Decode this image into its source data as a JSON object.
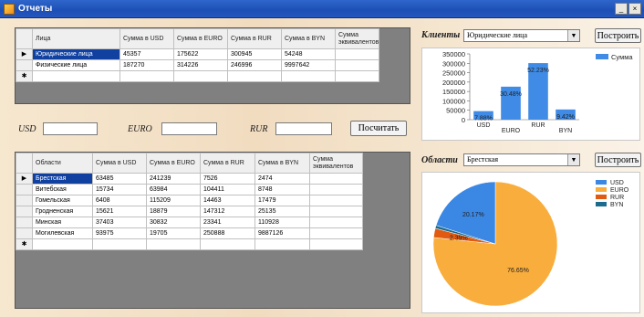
{
  "window": {
    "title": "Отчеты",
    "minimize_label": "_",
    "close_label": "×"
  },
  "clients_grid": {
    "columns": [
      "Лица",
      "Сумма в USD",
      "Сумма в EURO",
      "Сумма в RUR",
      "Сумма в BYN",
      "Сумма эквивалентов"
    ],
    "rows": [
      {
        "marker": "▶",
        "cells": [
          "Юридические лица",
          "45357",
          "175622",
          "300945",
          "54248",
          ""
        ]
      },
      {
        "marker": "",
        "cells": [
          "Физические лица",
          "187270",
          "314226",
          "246996",
          "9997642",
          ""
        ]
      }
    ],
    "new_row_marker": "✱"
  },
  "converter": {
    "usd_label": "USD",
    "usd_value": "",
    "euro_label": "EURO",
    "euro_value": "",
    "rur_label": "RUR",
    "rur_value": "",
    "calc_button": "Посчитать"
  },
  "regions_grid": {
    "columns": [
      "Области",
      "Сумма в USD",
      "Сумма в EURO",
      "Сумма в RUR",
      "Сумма в BYN",
      "Сумма эквивалентов"
    ],
    "rows": [
      {
        "marker": "▶",
        "cells": [
          "Брестская",
          "63485",
          "241239",
          "7526",
          "2474",
          ""
        ]
      },
      {
        "marker": "",
        "cells": [
          "Витебская",
          "15734",
          "63984",
          "104411",
          "8748",
          ""
        ]
      },
      {
        "marker": "",
        "cells": [
          "Гомельская",
          "6408",
          "115209",
          "14463",
          "17479",
          ""
        ]
      },
      {
        "marker": "",
        "cells": [
          "Гродненская",
          "15621",
          "18879",
          "147312",
          "25135",
          ""
        ]
      },
      {
        "marker": "",
        "cells": [
          "Минская",
          "37403",
          "30832",
          "23341",
          "110928",
          ""
        ]
      },
      {
        "marker": "",
        "cells": [
          "Могилевская",
          "93975",
          "19705",
          "250888",
          "9887126",
          ""
        ]
      }
    ],
    "new_row_marker": "✱"
  },
  "clients_panel": {
    "label": "Клиенты",
    "selected": "Юридические лица",
    "build_button": "Построить"
  },
  "regions_panel": {
    "label": "Области",
    "selected": "Брестская",
    "build_button": "Построить"
  },
  "chart_data": [
    {
      "type": "bar",
      "categories": [
        "USD",
        "EURO",
        "RUR",
        "BYN"
      ],
      "series": [
        {
          "name": "Сумма",
          "values": [
            45357,
            175622,
            300945,
            54248
          ]
        }
      ],
      "data_labels": [
        "7.88%",
        "30.48%",
        "52.23%",
        "9.42%"
      ],
      "yticks": [
        "0",
        "50000",
        "100000",
        "150000",
        "200000",
        "250000",
        "300000",
        "350000"
      ],
      "ylim": [
        0,
        350000
      ],
      "legend": "top-right",
      "color": "#3f8be6"
    },
    {
      "type": "pie",
      "labels": [
        "USD",
        "EURO",
        "RUR",
        "BYN"
      ],
      "values": [
        20.17,
        76.65,
        2.39,
        0.79
      ],
      "data_labels": [
        "20.17%",
        "76.65%",
        "2.39%",
        ""
      ],
      "colors": [
        "#3a87e4",
        "#f9ad3c",
        "#e05a12",
        "#1b6b8e"
      ],
      "legend": "top-right"
    }
  ]
}
